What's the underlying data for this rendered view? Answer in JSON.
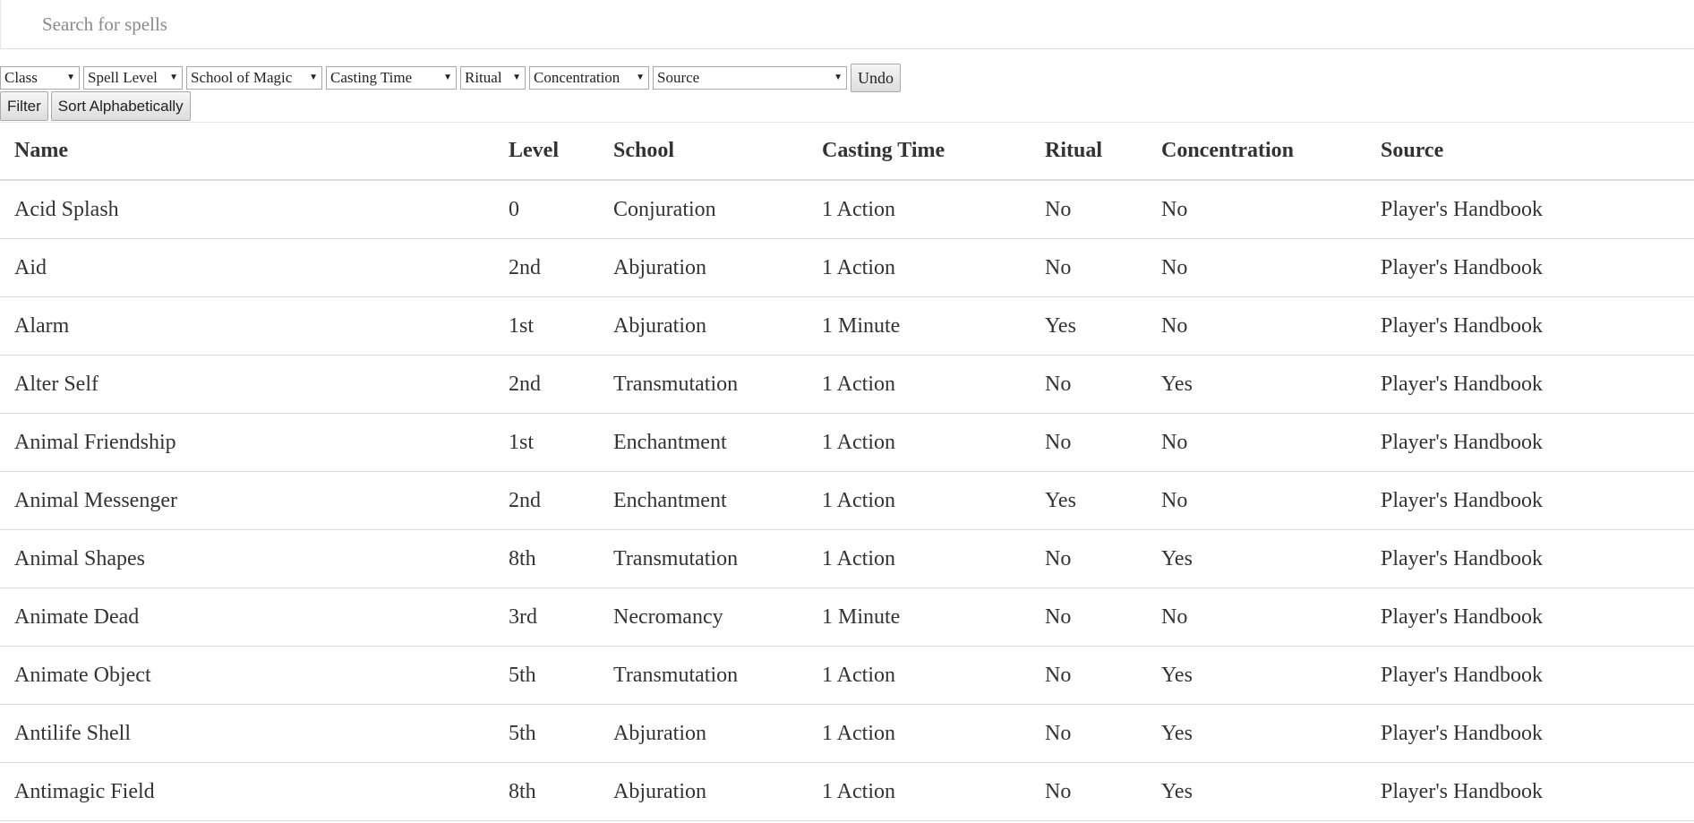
{
  "search": {
    "placeholder": "Search for spells",
    "value": ""
  },
  "filters": [
    {
      "label": "Class"
    },
    {
      "label": "Spell Level"
    },
    {
      "label": "School of Magic"
    },
    {
      "label": "Casting Time"
    },
    {
      "label": "Ritual"
    },
    {
      "label": "Concentration"
    },
    {
      "label": "Source"
    }
  ],
  "buttons": {
    "undo": "Undo",
    "filter": "Filter",
    "sort": "Sort Alphabetically"
  },
  "table": {
    "headers": {
      "name": "Name",
      "level": "Level",
      "school": "School",
      "casting_time": "Casting Time",
      "ritual": "Ritual",
      "concentration": "Concentration",
      "source": "Source"
    },
    "rows": [
      {
        "name": "Acid Splash",
        "level": "0",
        "school": "Conjuration",
        "casting_time": "1 Action",
        "ritual": "No",
        "concentration": "No",
        "source": "Player's Handbook"
      },
      {
        "name": "Aid",
        "level": "2nd",
        "school": "Abjuration",
        "casting_time": "1 Action",
        "ritual": "No",
        "concentration": "No",
        "source": "Player's Handbook"
      },
      {
        "name": "Alarm",
        "level": "1st",
        "school": "Abjuration",
        "casting_time": "1 Minute",
        "ritual": "Yes",
        "concentration": "No",
        "source": "Player's Handbook"
      },
      {
        "name": "Alter Self",
        "level": "2nd",
        "school": "Transmutation",
        "casting_time": "1 Action",
        "ritual": "No",
        "concentration": "Yes",
        "source": "Player's Handbook"
      },
      {
        "name": "Animal Friendship",
        "level": "1st",
        "school": "Enchantment",
        "casting_time": "1 Action",
        "ritual": "No",
        "concentration": "No",
        "source": "Player's Handbook"
      },
      {
        "name": "Animal Messenger",
        "level": "2nd",
        "school": "Enchantment",
        "casting_time": "1 Action",
        "ritual": "Yes",
        "concentration": "No",
        "source": "Player's Handbook"
      },
      {
        "name": "Animal Shapes",
        "level": "8th",
        "school": "Transmutation",
        "casting_time": "1 Action",
        "ritual": "No",
        "concentration": "Yes",
        "source": "Player's Handbook"
      },
      {
        "name": "Animate Dead",
        "level": "3rd",
        "school": "Necromancy",
        "casting_time": "1 Minute",
        "ritual": "No",
        "concentration": "No",
        "source": "Player's Handbook"
      },
      {
        "name": "Animate Object",
        "level": "5th",
        "school": "Transmutation",
        "casting_time": "1 Action",
        "ritual": "No",
        "concentration": "Yes",
        "source": "Player's Handbook"
      },
      {
        "name": "Antilife Shell",
        "level": "5th",
        "school": "Abjuration",
        "casting_time": "1 Action",
        "ritual": "No",
        "concentration": "Yes",
        "source": "Player's Handbook"
      },
      {
        "name": "Antimagic Field",
        "level": "8th",
        "school": "Abjuration",
        "casting_time": "1 Action",
        "ritual": "No",
        "concentration": "Yes",
        "source": "Player's Handbook"
      }
    ]
  }
}
